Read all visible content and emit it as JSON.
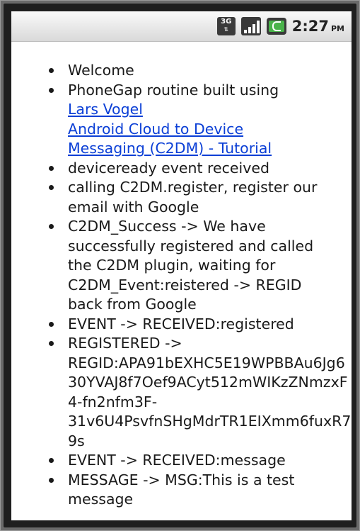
{
  "status_bar": {
    "network_type": "3G",
    "network_arrows": "⇅",
    "signal_icon": "signal-strength-icon",
    "battery_icon": "battery-charging-icon",
    "time": "2:27",
    "ampm": "PM",
    "colors": {
      "battery": "#49b34a",
      "icon_bg": "#3a3a3a"
    }
  },
  "log": {
    "items": [
      {
        "text": "Welcome"
      },
      {
        "text": "PhoneGap routine built using",
        "links": [
          "Lars Vogel",
          "Android Cloud to Device Messaging (C2DM) - Tutorial"
        ]
      },
      {
        "text": "deviceready event received"
      },
      {
        "text": "calling C2DM.register, register our email with Google"
      },
      {
        "text": "C2DM_Success -> We have successfully registered and called the C2DM plugin, waiting for C2DM_Event:reistered -> REGID back from Google"
      },
      {
        "text": "EVENT -> RECEIVED:registered"
      },
      {
        "text_lines": [
          "REGISTERED ->",
          "REGID:APA91bEXHC5E19WPBBAu6Jg6",
          "30YVAJ8f7Oef9ACyt512mWIKzZNmzxF",
          "4-fn2nfm3F-",
          "31v6U4PsvfnSHgMdrTR1EIXmm6fuxR7",
          "9s"
        ]
      },
      {
        "text": "EVENT -> RECEIVED:message"
      },
      {
        "text": "MESSAGE -> MSG:This is a test message"
      }
    ],
    "link_color": "#0b3fd6"
  }
}
